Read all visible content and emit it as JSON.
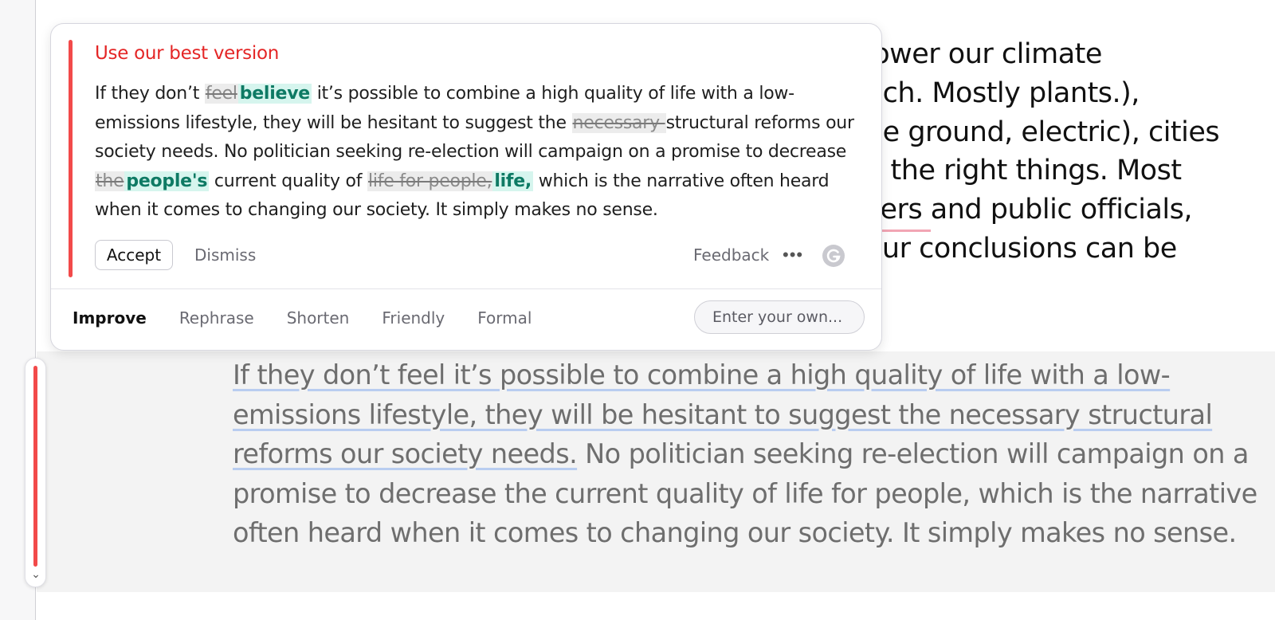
{
  "background_doc": {
    "lines": [
      "lower our climate",
      "uch. Mostly plants.),",
      "ne ground, electric), cities",
      "o the right things. Most",
      "kers and public officials,",
      "our conclusions can be"
    ]
  },
  "paragraph": {
    "underlined_part": "If they don’t feel it’s possible to combine a high quality of life with a low-emissions lifestyle, they will be hesitant to suggest the necessary structural reforms our society needs.",
    "rest": " No politician seeking re-election will campaign on a promise to decrease the current quality of life for people, which is the narrative often heard when it comes to changing our society. It simply makes no sense."
  },
  "popover": {
    "title": "Use our best version",
    "segments": {
      "s1": "If they don’t ",
      "d1": "feel",
      "i1": "believe",
      "s2": " it’s possible to combine a high quality of life with a low-emissions lifestyle, they will be hesitant to suggest the ",
      "d2": "necessary ",
      "s3": "structural reforms our society needs. No politician seeking re-election will campaign on a promise to decrease ",
      "d3": "the",
      "i3": "people's",
      "s4": " current quality of ",
      "d4": "life for people,",
      "i4": "life,",
      "s5": " which is the narrative often heard when it comes to changing our society. It simply makes no sense."
    },
    "accept_label": "Accept",
    "dismiss_label": "Dismiss",
    "feedback_label": "Feedback",
    "more_icon": "•••",
    "tabs": [
      {
        "label": "Improve",
        "active": true
      },
      {
        "label": "Rephrase"
      },
      {
        "label": "Shorten"
      },
      {
        "label": "Friendly"
      },
      {
        "label": "Formal"
      }
    ],
    "custom_input_placeholder": "Enter your own..."
  },
  "side_indicator": {
    "chevron": "⌄"
  },
  "colors": {
    "accent_red": "#f24a4a",
    "insert_green": "#0e7a64",
    "insert_bg": "#d6f5ee",
    "underline_blue": "#b9cdf0"
  },
  "icons": {
    "more": "more-dots-icon",
    "brand": "grammarly-g-icon",
    "chevron": "chevron-down-icon"
  }
}
